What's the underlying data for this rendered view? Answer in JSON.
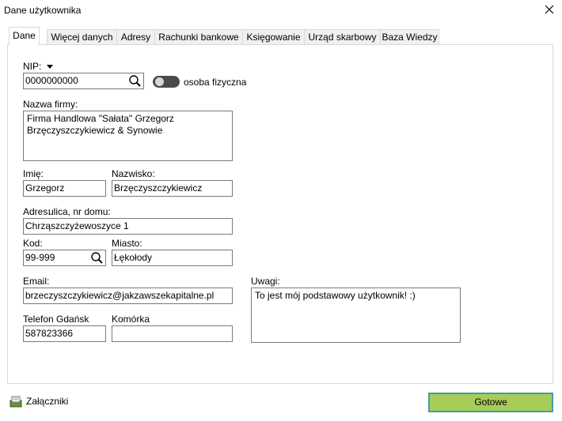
{
  "window": {
    "title": "Dane użytkownika"
  },
  "tabs": [
    {
      "label": "Dane",
      "active": true
    },
    {
      "label": "Więcej danych"
    },
    {
      "label": "Adresy"
    },
    {
      "label": "Rachunki bankowe"
    },
    {
      "label": "Księgowanie"
    },
    {
      "label": "Urząd skarbowy"
    },
    {
      "label": "Baza Wiedzy"
    }
  ],
  "form": {
    "nip_label": "NIP:",
    "nip_value": "0000000000",
    "toggle_label": "osoba fizyczna",
    "company_label": "Nazwa firmy:",
    "company_value": "Firma Handlowa \"Sałata\" Grzegorz\nBrzęczyszczykiewicz & Synowie",
    "first_name_label": "Imię:",
    "first_name_value": "Grzegorz",
    "last_name_label": "Nazwisko:",
    "last_name_value": "Brzęczyszczykiewicz",
    "address_label": "Adres:",
    "address_sublabel": "ulica, nr domu:",
    "address_value": "Chrząszczyżewoszyce 1",
    "postal_label": "Kod:",
    "postal_value": "99-999",
    "city_label": "Miasto:",
    "city_value": "Łękołody",
    "email_label": "Email:",
    "email_value": "brzeczyszczykiewicz@jakzawszekapitalne.pl",
    "notes_label": "Uwagi:",
    "notes_value": "To jest mój podstawowy użytkownik! :)",
    "phone_label": "Telefon Gdańsk",
    "phone_value": "587823366",
    "mobile_label": "Komórka",
    "mobile_value": ""
  },
  "footer": {
    "attachments_label": "Załączniki",
    "done_label": "Gotowe"
  },
  "colors": {
    "done_button": "#a6cc5a",
    "done_border": "#3c9ea8",
    "toggle_track": "#4a4a4a"
  }
}
